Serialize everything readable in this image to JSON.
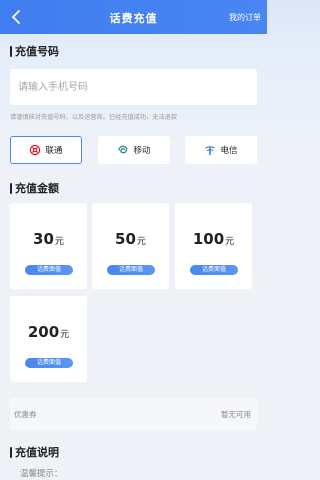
{
  "header": {
    "title": "话费充值",
    "orders_label": "我的订单"
  },
  "phone": {
    "section_title": "充值号码",
    "placeholder": "请输入手机号码",
    "note": "请谨慎核对充值号码，以及运营商。已经充值成功，无法退款"
  },
  "carriers": [
    {
      "label": "联通",
      "icon": "china-unicom-icon",
      "selected": true,
      "color": "#e60012"
    },
    {
      "label": "移动",
      "icon": "china-mobile-icon",
      "selected": false,
      "color": "#2a8c8c"
    },
    {
      "label": "电信",
      "icon": "china-telecom-icon",
      "selected": false,
      "color": "#2a6fc9"
    }
  ],
  "amount": {
    "section_title": "充值金额",
    "options": [
      {
        "value": "30",
        "unit": "元",
        "tag": "话费面值"
      },
      {
        "value": "50",
        "unit": "元",
        "tag": "话费面值"
      },
      {
        "value": "100",
        "unit": "元",
        "tag": "话费面值"
      },
      {
        "value": "200",
        "unit": "元",
        "tag": "话费面值"
      }
    ]
  },
  "coupon": {
    "label": "优惠券",
    "value": "暂无可用"
  },
  "instructions": {
    "section_title": "充值说明",
    "tip": "温馨提示："
  },
  "colors": {
    "accent": "#4a86f2",
    "header_bg": "#3f7df0"
  }
}
